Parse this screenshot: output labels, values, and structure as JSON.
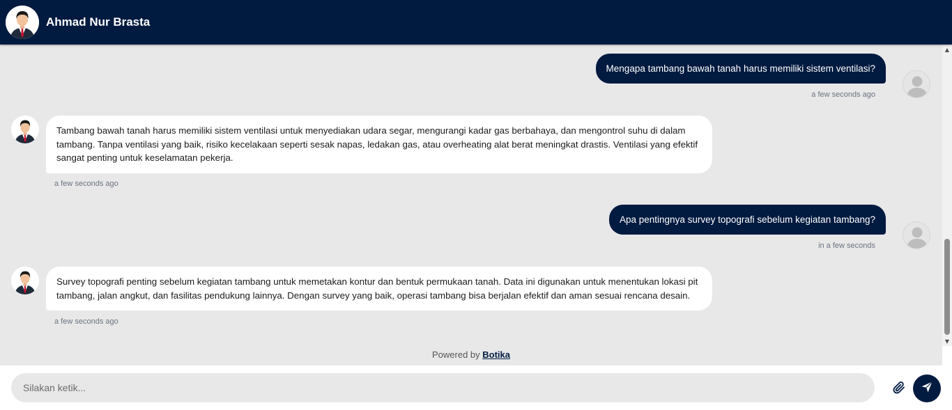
{
  "header": {
    "title": "Ahmad Nur Brasta",
    "avatar_icon": "businessman-avatar-icon",
    "background_color": "#001a40"
  },
  "messages": [
    {
      "sender": "user",
      "text": "Mengapa tambang bawah tanah harus memiliki sistem ventilasi?",
      "time": "a few seconds ago"
    },
    {
      "sender": "bot",
      "text": "Tambang bawah tanah harus memiliki sistem ventilasi untuk menyediakan udara segar, mengurangi kadar gas berbahaya, dan mengontrol suhu di dalam tambang. Tanpa ventilasi yang baik, risiko kecelakaan seperti sesak napas, ledakan gas, atau overheating alat berat meningkat drastis. Ventilasi yang efektif sangat penting untuk keselamatan pekerja.",
      "time": "a few seconds ago"
    },
    {
      "sender": "user",
      "text": "Apa pentingnya survey topografi sebelum kegiatan tambang?",
      "time": "in a few seconds"
    },
    {
      "sender": "bot",
      "text": "Survey topografi penting sebelum kegiatan tambang untuk memetakan kontur dan bentuk permukaan tanah. Data ini digunakan untuk menentukan lokasi pit tambang, jalan angkut, dan fasilitas pendukung lainnya. Dengan survey yang baik, operasi tambang bisa berjalan efektif dan aman sesuai rencana desain.",
      "time": "a few seconds ago"
    }
  ],
  "footer": {
    "powered_prefix": "Powered by",
    "powered_link": "Botika"
  },
  "composer": {
    "placeholder": "Silakan ketik...",
    "value": "",
    "attach_icon": "paperclip-icon",
    "send_icon": "paper-plane-icon"
  },
  "colors": {
    "primary": "#001a40",
    "chat_background": "#e8e8e8",
    "bot_bubble": "#ffffff"
  }
}
